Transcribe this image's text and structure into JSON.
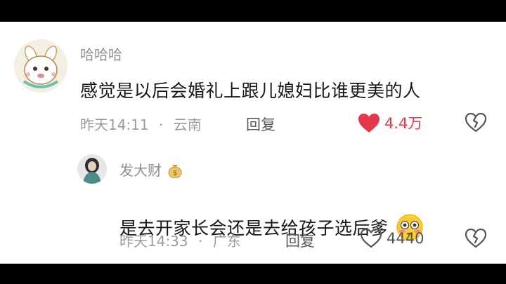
{
  "colors": {
    "liked_red": "#e5374b",
    "muted_gray": "#9b9b9b",
    "icon_gray": "#555555"
  },
  "comments": [
    {
      "username": "哈哈哈",
      "text": "感觉是以后会婚礼上跟儿媳妇比谁更美的人",
      "time": "昨天14:11",
      "separator": "·",
      "location": "云南",
      "reply_label": "回复",
      "like_count": "4.4万",
      "liked": true,
      "avatar_icon": "cartoon-bunny-avatar",
      "like_icon": "heart-filled-icon",
      "dislike_icon": "broken-heart-icon"
    },
    {
      "username": "发大财",
      "username_emoji": "money-bag-emoji",
      "text": "是去开家长会还是去给孩子选后爹",
      "text_emoji": "flushed-face-emoji",
      "time": "昨天14:33",
      "separator": "·",
      "location": "广东",
      "reply_label": "回复",
      "like_count": "4440",
      "liked": false,
      "avatar_icon": "woman-photo-avatar",
      "like_icon": "heart-outline-icon",
      "dislike_icon": "broken-heart-icon"
    }
  ]
}
